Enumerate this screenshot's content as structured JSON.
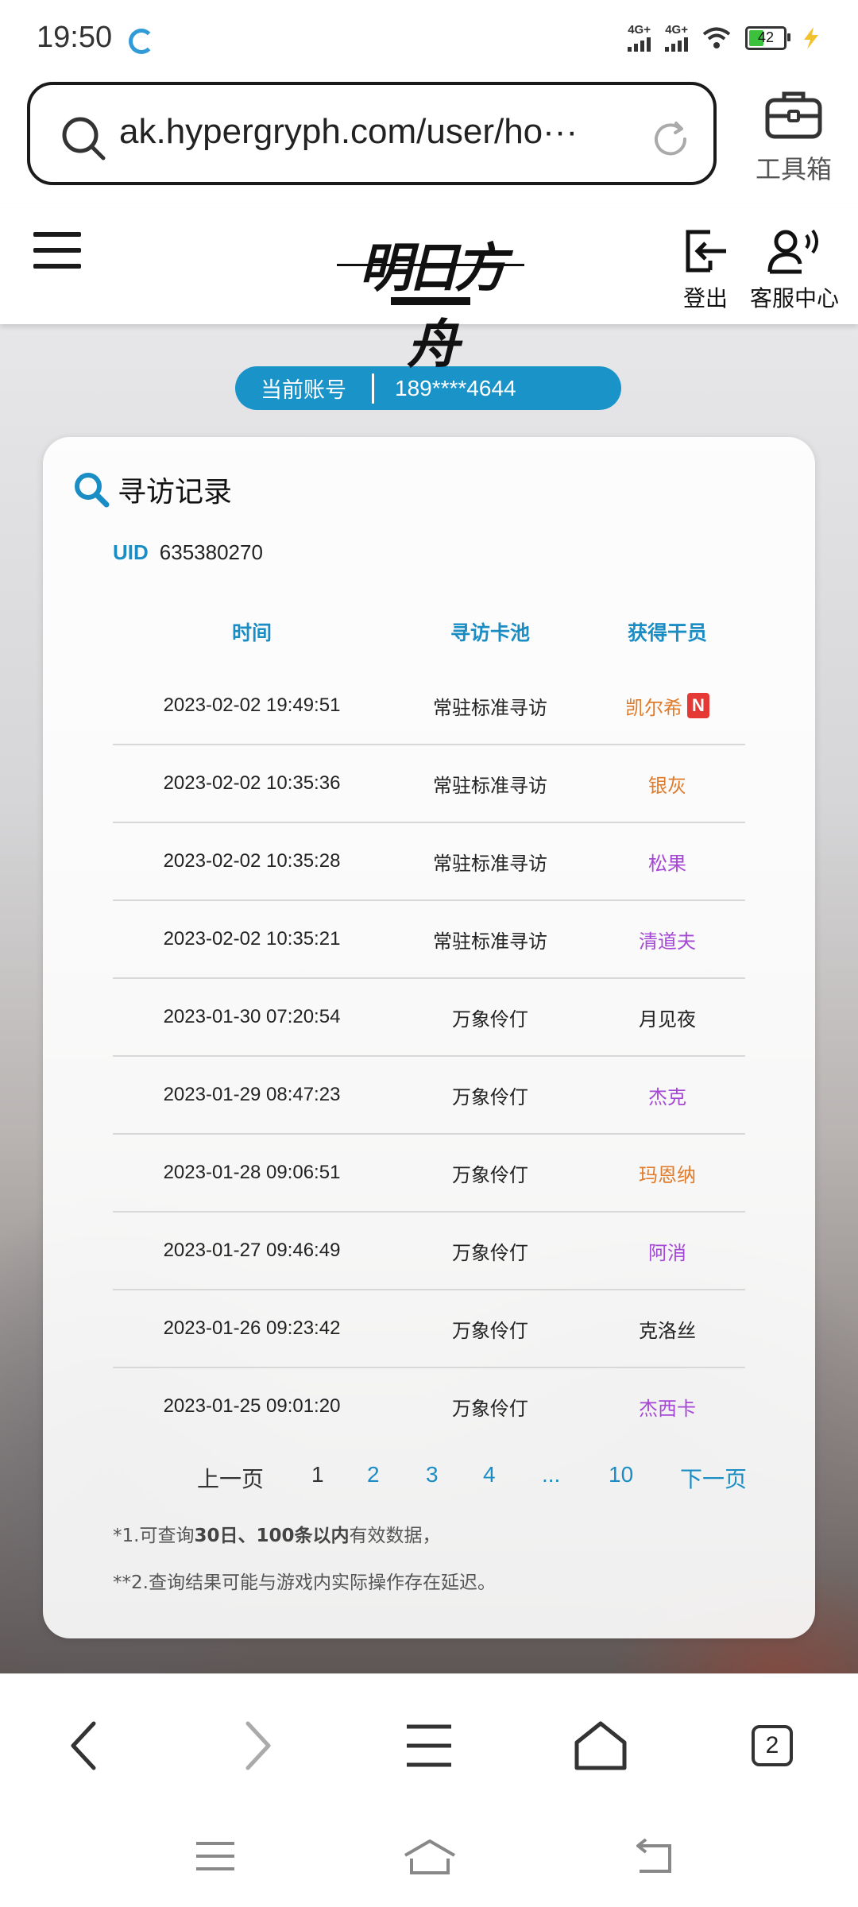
{
  "status_bar": {
    "time": "19:50",
    "signal1_label": "4G+",
    "signal2_label": "4G+",
    "battery_level": "42",
    "icons": [
      "loading-icon",
      "signal-icon",
      "wifi-icon",
      "battery-icon",
      "charging-icon"
    ]
  },
  "browser": {
    "url": "ak.hypergryph.com/user/ho···",
    "toolbox_label": "工具箱"
  },
  "site_header": {
    "logo_text": "明日方舟",
    "logout_label": "登出",
    "service_label": "客服中心"
  },
  "account": {
    "label": "当前账号",
    "value": "189****4644"
  },
  "card": {
    "title": "寻访记录",
    "uid_label": "UID",
    "uid_value": "635380270",
    "columns": [
      "时间",
      "寻访卡池",
      "获得干员"
    ],
    "rows": [
      {
        "time": "2023-02-02 19:49:51",
        "pool": "常驻标准寻访",
        "operator": "凯尔希",
        "color": "#e07b2b",
        "badge": "N"
      },
      {
        "time": "2023-02-02 10:35:36",
        "pool": "常驻标准寻访",
        "operator": "银灰",
        "color": "#e07b2b",
        "badge": ""
      },
      {
        "time": "2023-02-02 10:35:28",
        "pool": "常驻标准寻访",
        "operator": "松果",
        "color": "#a548d6",
        "badge": ""
      },
      {
        "time": "2023-02-02 10:35:21",
        "pool": "常驻标准寻访",
        "operator": "清道夫",
        "color": "#a548d6",
        "badge": ""
      },
      {
        "time": "2023-01-30 07:20:54",
        "pool": "万象伶仃",
        "operator": "月见夜",
        "color": "#222222",
        "badge": ""
      },
      {
        "time": "2023-01-29 08:47:23",
        "pool": "万象伶仃",
        "operator": "杰克",
        "color": "#a548d6",
        "badge": ""
      },
      {
        "time": "2023-01-28 09:06:51",
        "pool": "万象伶仃",
        "operator": "玛恩纳",
        "color": "#e07b2b",
        "badge": ""
      },
      {
        "time": "2023-01-27 09:46:49",
        "pool": "万象伶仃",
        "operator": "阿消",
        "color": "#a548d6",
        "badge": ""
      },
      {
        "time": "2023-01-26 09:23:42",
        "pool": "万象伶仃",
        "operator": "克洛丝",
        "color": "#222222",
        "badge": ""
      },
      {
        "time": "2023-01-25 09:01:20",
        "pool": "万象伶仃",
        "operator": "杰西卡",
        "color": "#a548d6",
        "badge": ""
      }
    ],
    "pagination": {
      "prev": "上一页",
      "current": "1",
      "pages": [
        "2",
        "3",
        "4",
        "...",
        "10"
      ],
      "next": "下一页"
    },
    "note1_prefix": "*1.可查询",
    "note1_bold": "30日、100条以内",
    "note1_suffix": "有效数据，",
    "note2": "**2.查询结果可能与游戏内实际操作存在延迟。"
  },
  "browser_toolbar": {
    "tab_count": "2"
  }
}
